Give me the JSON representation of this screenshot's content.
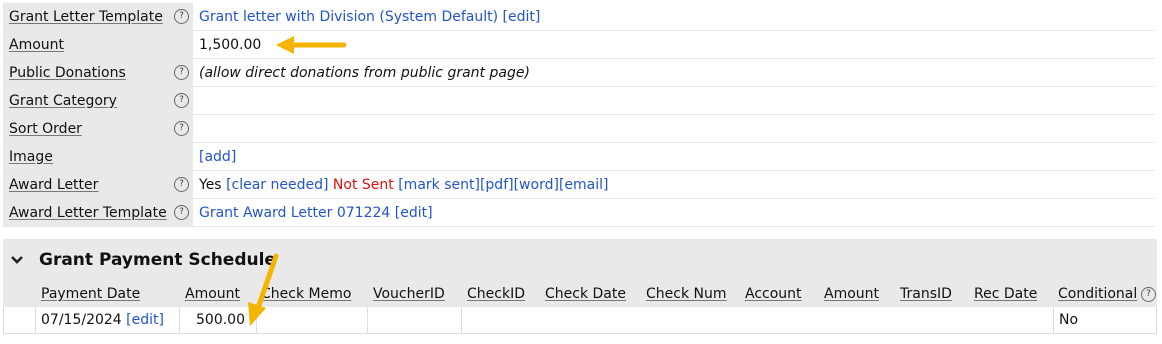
{
  "properties": [
    {
      "label": "Grant Letter Template",
      "help": true,
      "parts": [
        {
          "text": "Grant letter with Division (System Default) [edit]",
          "style": "link"
        }
      ]
    },
    {
      "label": "Amount",
      "help": false,
      "parts": [
        {
          "text": "1,500.00",
          "style": "plain"
        }
      ]
    },
    {
      "label": "Public Donations",
      "help": true,
      "parts": [
        {
          "text": "(allow direct donations from public grant page)",
          "style": "ital"
        }
      ]
    },
    {
      "label": "Grant Category",
      "help": true,
      "parts": []
    },
    {
      "label": "Sort Order",
      "help": true,
      "parts": []
    },
    {
      "label": "Image",
      "help": false,
      "parts": [
        {
          "text": "[add]",
          "style": "link"
        }
      ]
    },
    {
      "label": "Award Letter",
      "help": true,
      "parts": [
        {
          "text": "Yes ",
          "style": "plain"
        },
        {
          "text": "[clear needed]",
          "style": "link"
        },
        {
          "text": " ",
          "style": "plain"
        },
        {
          "text": "Not Sent",
          "style": "red"
        },
        {
          "text": " ",
          "style": "plain"
        },
        {
          "text": "[mark sent]",
          "style": "link"
        },
        {
          "text": "[pdf]",
          "style": "link"
        },
        {
          "text": "[word]",
          "style": "link"
        },
        {
          "text": "[email]",
          "style": "link"
        }
      ]
    },
    {
      "label": "Award Letter Template",
      "help": true,
      "parts": [
        {
          "text": "Grant Award Letter 071224 [edit]",
          "style": "link"
        }
      ]
    }
  ],
  "schedule": {
    "title": "Grant Payment Schedule",
    "columns": [
      "Payment Date",
      "Amount",
      "Check Memo",
      "VoucherID",
      "CheckID",
      "Check Date",
      "Check Num",
      "Account",
      "Amount",
      "TransID",
      "Rec Date",
      "Conditional"
    ],
    "row": {
      "payment_date": "07/15/2024",
      "edit_link": "[edit]",
      "amount": "500.00",
      "conditional": "No"
    }
  },
  "help_glyph": "?",
  "colors": {
    "link": "#2255cc",
    "not_sent": "#dd1111",
    "label_bg": "#e9e9e9",
    "arrow": "#f5b400"
  }
}
